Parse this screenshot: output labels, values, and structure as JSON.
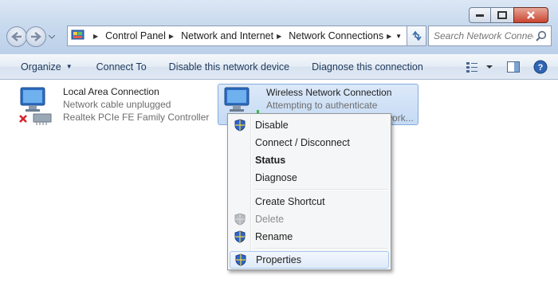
{
  "window": {
    "controls": [
      "minimize",
      "maximize",
      "close"
    ]
  },
  "address_bar": {
    "crumbs": [
      "Control Panel",
      "Network and Internet",
      "Network Connections"
    ]
  },
  "search": {
    "placeholder": "Search Network Connec..."
  },
  "toolbar": {
    "organize": "Organize",
    "connect_to": "Connect To",
    "disable_device": "Disable this network device",
    "diagnose": "Diagnose this connection"
  },
  "connections": {
    "lan": {
      "name": "Local Area Connection",
      "status": "Network cable unplugged",
      "device": "Realtek PCIe FE Family Controller"
    },
    "wifi": {
      "name": "Wireless Network Connection",
      "status": "Attempting to authenticate",
      "device_partial": "twork..."
    }
  },
  "context_menu": {
    "disable": "Disable",
    "connect_disconnect": "Connect / Disconnect",
    "status": "Status",
    "diagnose": "Diagnose",
    "create_shortcut": "Create Shortcut",
    "delete": "Delete",
    "rename": "Rename",
    "properties": "Properties"
  },
  "colors": {
    "accent": "#1e395b",
    "selection": "#c5daf4",
    "close_button": "#c9452f"
  }
}
